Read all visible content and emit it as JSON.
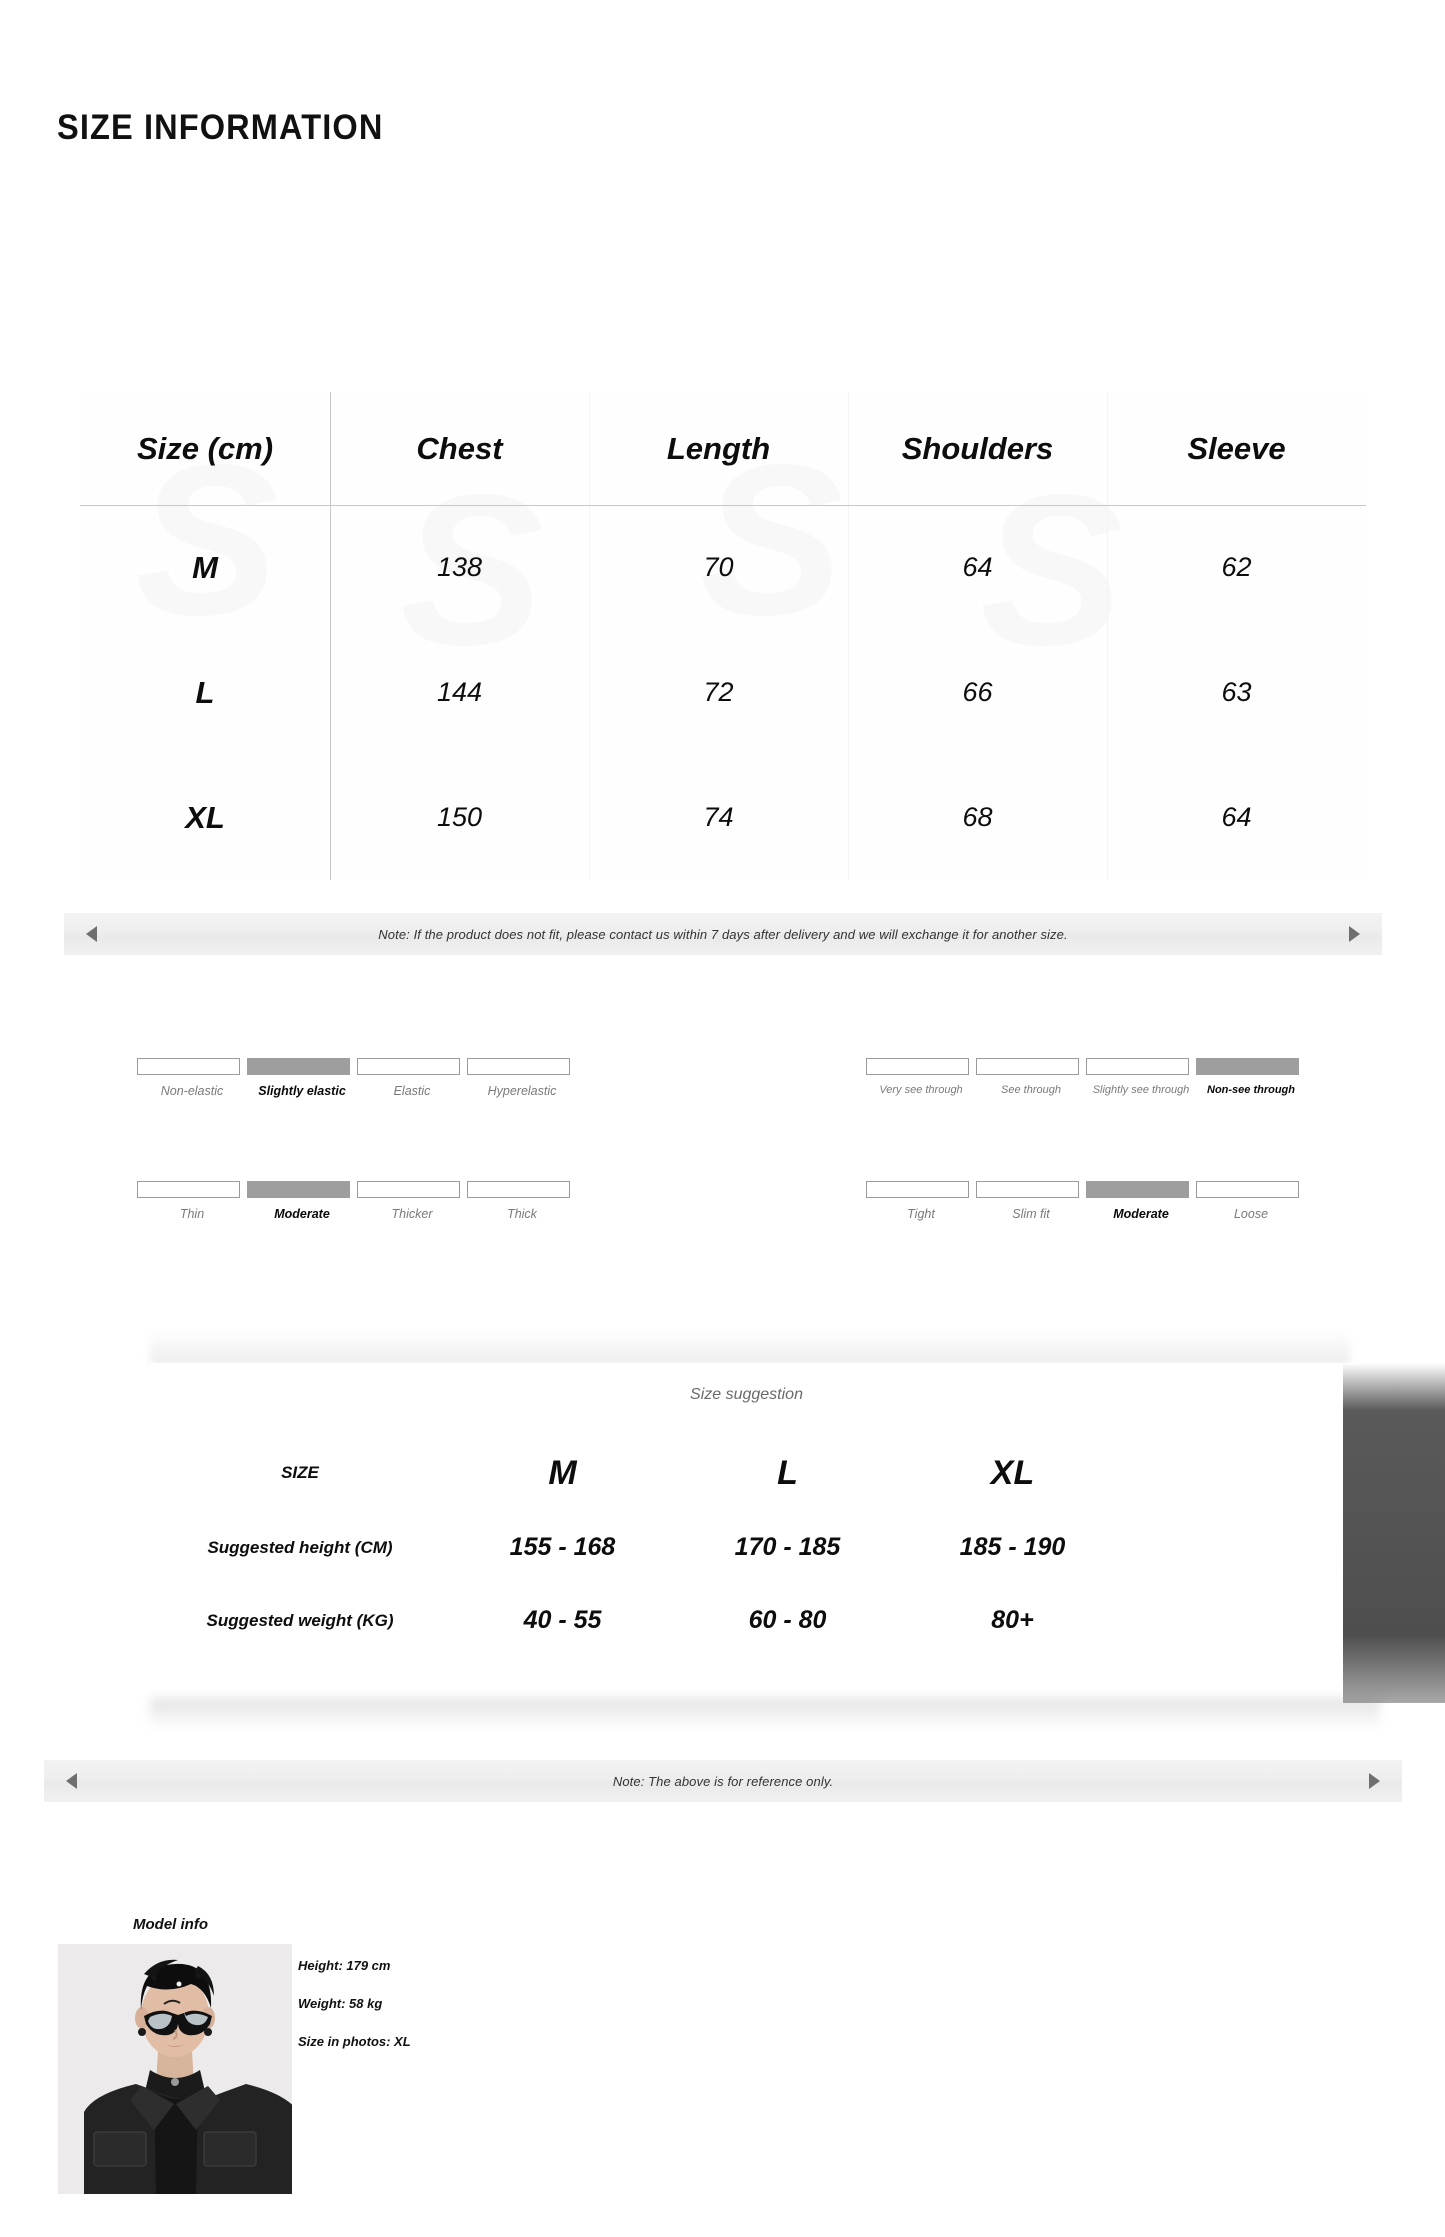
{
  "page_title": "SIZE INFORMATION",
  "size_table": {
    "columns": [
      "Size (cm)",
      "Chest",
      "Length",
      "Shoulders",
      "Sleeve"
    ],
    "rows": [
      {
        "size": "M",
        "chest": "138",
        "length": "70",
        "shoulders": "64",
        "sleeve": "62"
      },
      {
        "size": "L",
        "chest": "144",
        "length": "72",
        "shoulders": "66",
        "sleeve": "63"
      },
      {
        "size": "XL",
        "chest": "150",
        "length": "74",
        "shoulders": "68",
        "sleeve": "64"
      }
    ],
    "watermark": "S"
  },
  "notes": {
    "top": "Note: If the product does not fit, please contact us within 7 days after delivery and we will exchange it for another size.",
    "bottom": "Note: The above is for reference only."
  },
  "properties": {
    "elasticity": {
      "options": [
        "Non-elastic",
        "Slightly elastic",
        "Elastic",
        "Hyperelastic"
      ],
      "selected": "Slightly elastic"
    },
    "thickness": {
      "options": [
        "Thin",
        "Moderate",
        "Thicker",
        "Thick"
      ],
      "selected": "Moderate"
    },
    "sheerness": {
      "options": [
        "Very see through",
        "See through",
        "Slightly see through",
        "Non-see through"
      ],
      "selected": "Non-see through"
    },
    "fit": {
      "options": [
        "Tight",
        "Slim fit",
        "Moderate",
        "Loose"
      ],
      "selected": "Moderate"
    },
    "selected_fill_color": "#9e9e9e",
    "unselected_border_color": "#9a9a9a"
  },
  "size_suggestion": {
    "title": "Size suggestion",
    "size_row_label": "SIZE",
    "sizes": [
      "M",
      "L",
      "XL"
    ],
    "rows": [
      {
        "label": "Suggested height (CM)",
        "values": [
          "155 - 168",
          "170 - 185",
          "185 - 190"
        ]
      },
      {
        "label": "Suggested weight (KG)",
        "values": [
          "40 - 55",
          "60 - 80",
          "80+"
        ]
      }
    ]
  },
  "model_info": {
    "label": "Model info",
    "height": "Height: 179 cm",
    "weight": "Weight: 58 kg",
    "size_in_photos": "Size in photos: XL",
    "photo_alt": "model-photo"
  }
}
